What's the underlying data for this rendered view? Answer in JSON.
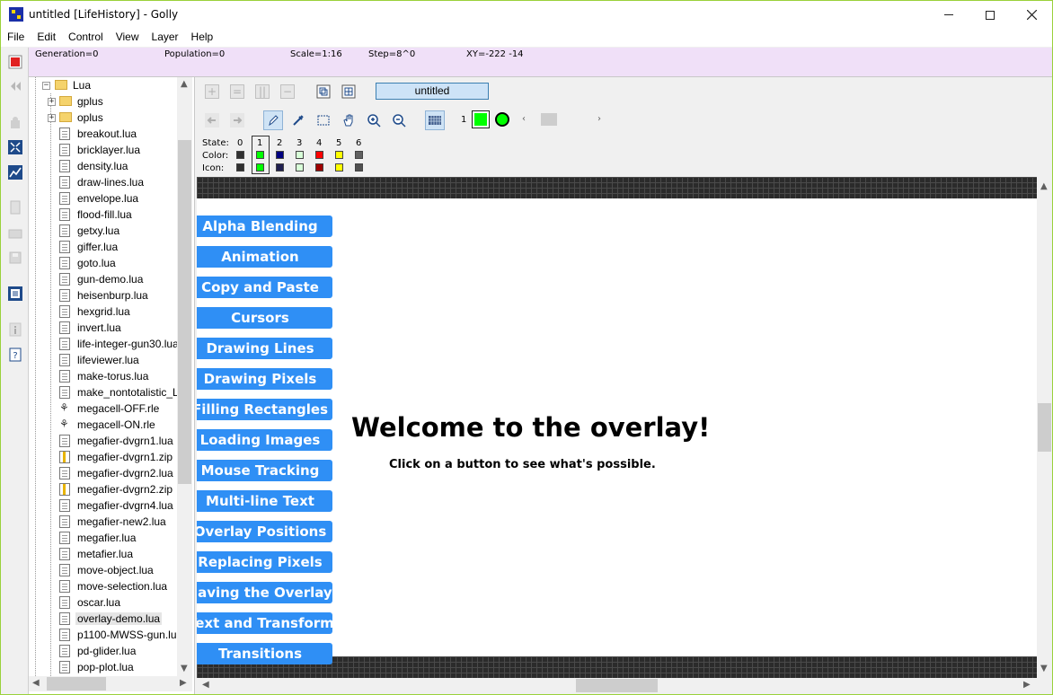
{
  "window": {
    "title": "untitled [LifeHistory] - Golly",
    "minimize_label": "—",
    "maximize_label": "☐",
    "close_label": "✕"
  },
  "menu": [
    "File",
    "Edit",
    "Control",
    "View",
    "Layer",
    "Help"
  ],
  "infobar": {
    "generation": "Generation=0",
    "population": "Population=0",
    "scale": "Scale=1:16",
    "step": "Step=8^0",
    "xy": "XY=-222 -14"
  },
  "left_toolbar": [
    {
      "icon": "stop-icon",
      "enabled": true
    },
    {
      "icon": "reset-icon",
      "enabled": false
    },
    {
      "icon": "undo-icon",
      "enabled": false
    },
    {
      "icon": "fit-pattern-icon",
      "enabled": true
    },
    {
      "icon": "scripts-icon",
      "enabled": true
    },
    {
      "icon": "new-pattern-icon",
      "enabled": false
    },
    {
      "icon": "open-icon",
      "enabled": false
    },
    {
      "icon": "save-icon",
      "enabled": false
    },
    {
      "icon": "show-files-icon",
      "enabled": true
    },
    {
      "icon": "info-icon",
      "enabled": false
    },
    {
      "icon": "help-icon",
      "enabled": true
    }
  ],
  "tree": {
    "root_folder": "Lua",
    "subfolders": [
      "gplus",
      "oplus"
    ],
    "files": [
      {
        "name": "breakout.lua",
        "type": "lua"
      },
      {
        "name": "bricklayer.lua",
        "type": "lua"
      },
      {
        "name": "density.lua",
        "type": "lua"
      },
      {
        "name": "draw-lines.lua",
        "type": "lua"
      },
      {
        "name": "envelope.lua",
        "type": "lua"
      },
      {
        "name": "flood-fill.lua",
        "type": "lua"
      },
      {
        "name": "getxy.lua",
        "type": "lua"
      },
      {
        "name": "giffer.lua",
        "type": "lua"
      },
      {
        "name": "goto.lua",
        "type": "lua"
      },
      {
        "name": "gun-demo.lua",
        "type": "lua"
      },
      {
        "name": "heisenburp.lua",
        "type": "lua"
      },
      {
        "name": "hexgrid.lua",
        "type": "lua"
      },
      {
        "name": "invert.lua",
        "type": "lua"
      },
      {
        "name": "life-integer-gun30.lua",
        "type": "lua"
      },
      {
        "name": "lifeviewer.lua",
        "type": "lua"
      },
      {
        "name": "make-torus.lua",
        "type": "lua"
      },
      {
        "name": "make_nontotalistic_L",
        "type": "lua"
      },
      {
        "name": "megacell-OFF.rle",
        "type": "rle"
      },
      {
        "name": "megacell-ON.rle",
        "type": "rle"
      },
      {
        "name": "megafier-dvgrn1.lua",
        "type": "lua"
      },
      {
        "name": "megafier-dvgrn1.zip",
        "type": "zip"
      },
      {
        "name": "megafier-dvgrn2.lua",
        "type": "lua"
      },
      {
        "name": "megafier-dvgrn2.zip",
        "type": "zip"
      },
      {
        "name": "megafier-dvgrn4.lua",
        "type": "lua"
      },
      {
        "name": "megafier-new2.lua",
        "type": "lua"
      },
      {
        "name": "megafier.lua",
        "type": "lua"
      },
      {
        "name": "metafier.lua",
        "type": "lua"
      },
      {
        "name": "move-object.lua",
        "type": "lua"
      },
      {
        "name": "move-selection.lua",
        "type": "lua"
      },
      {
        "name": "oscar.lua",
        "type": "lua"
      },
      {
        "name": "overlay-demo.lua",
        "type": "lua",
        "selected": true
      },
      {
        "name": "p1100-MWSS-gun.lua",
        "type": "lua"
      },
      {
        "name": "pd-glider.lua",
        "type": "lua"
      },
      {
        "name": "pop-plot.lua",
        "type": "lua"
      }
    ]
  },
  "layer_bar": {
    "layer_name": "untitled",
    "buttons": [
      "+",
      "=",
      "||",
      "−"
    ]
  },
  "edit_bar": {
    "current_state": "1",
    "state_label": "State:",
    "color_label": "Color:",
    "icon_label": "Icon:",
    "states": [
      "0",
      "1",
      "2",
      "3",
      "4",
      "5",
      "6"
    ],
    "state_colors": [
      "#303030",
      "#00ff00",
      "#000080",
      "#d8ffd8",
      "#ff0000",
      "#ffff00",
      "#606060"
    ],
    "icon_colors": [
      "#303030",
      "#00ff00",
      "#202050",
      "#d8ffd8",
      "#a00000",
      "#ffff00",
      "#505050"
    ]
  },
  "overlay": {
    "heading": "Welcome to the overlay!",
    "subtext": "Click on a button to see what's possible.",
    "buttons": [
      "Alpha Blending",
      "Animation",
      "Copy and Paste",
      "Cursors",
      "Drawing Lines",
      "Drawing Pixels",
      "Filling Rectangles",
      "Loading Images",
      "Mouse Tracking",
      "Multi-line Text",
      "Overlay Positions",
      "Replacing Pixels",
      "Saving the Overlay",
      "Text and Transforms",
      "Transitions"
    ]
  },
  "colors": {
    "overlay_button": "#2f8ff5",
    "infobar_bg": "#f0e0f8",
    "window_border": "#9ad13a",
    "grid_bg": "#2b2b2b"
  }
}
